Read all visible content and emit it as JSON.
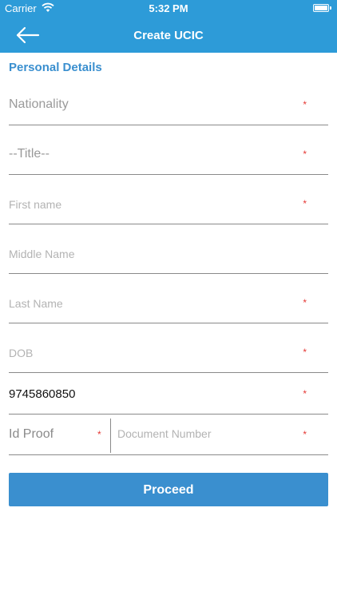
{
  "status_bar": {
    "carrier": "Carrier",
    "time": "5:32 PM"
  },
  "navbar": {
    "title": "Create UCIC",
    "back_icon": "arrow-left-icon"
  },
  "section": {
    "title": "Personal Details"
  },
  "fields": {
    "nationality": {
      "label": "Nationality",
      "required": "*"
    },
    "title": {
      "label": "--Title--",
      "required": "*"
    },
    "first_name": {
      "label": "First name",
      "required": "*"
    },
    "middle_name": {
      "label": "Middle Name"
    },
    "last_name": {
      "label": "Last Name",
      "required": "*"
    },
    "dob": {
      "label": "DOB",
      "required": "*"
    },
    "mobile": {
      "value": "9745860850",
      "required": "*"
    },
    "id_proof": {
      "label": "Id Proof",
      "required": "*"
    },
    "document_number": {
      "label": "Document Number",
      "required": "*"
    }
  },
  "actions": {
    "proceed": "Proceed"
  },
  "colors": {
    "primary": "#2d9bd8",
    "button": "#3a8fcf",
    "required": "#e53935"
  }
}
